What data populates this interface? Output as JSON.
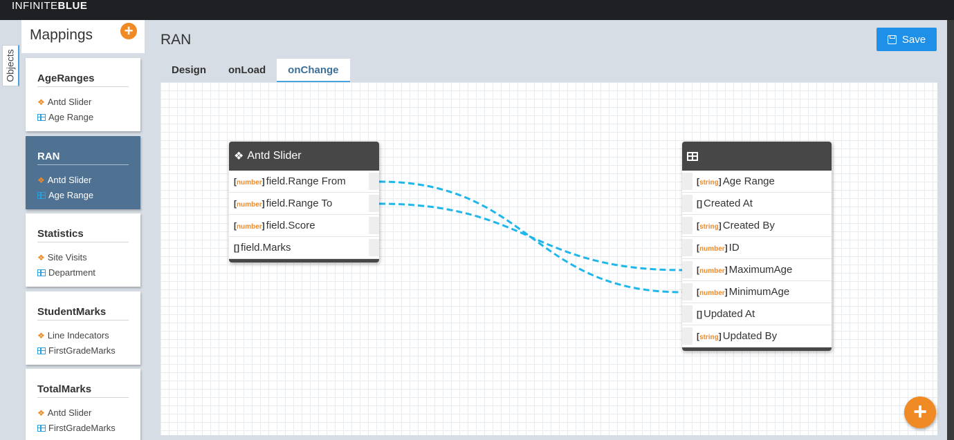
{
  "app": {
    "brand_thin": "INFINITE",
    "brand_bold": "BLUE"
  },
  "side_tab": {
    "label": "Objects"
  },
  "mappings": {
    "title": "Mappings",
    "add_label": "+",
    "items": [
      {
        "name": "AgeRanges",
        "component": "Antd Slider",
        "object": "Age Range"
      },
      {
        "name": "RAN",
        "component": "Antd Slider",
        "object": "Age Range"
      },
      {
        "name": "Statistics",
        "component": "Site Visits",
        "object": "Department"
      },
      {
        "name": "StudentMarks",
        "component": "Line Indecators",
        "object": "FirstGradeMarks"
      },
      {
        "name": "TotalMarks",
        "component": "Antd Slider",
        "object": "FirstGradeMarks"
      }
    ],
    "active_index": 1
  },
  "main": {
    "title": "RAN",
    "save_label": "Save",
    "tabs": [
      {
        "label": "Design"
      },
      {
        "label": "onLoad"
      },
      {
        "label": "onChange"
      }
    ],
    "active_tab": 2,
    "fab_label": "+"
  },
  "left_node": {
    "title": "Antd Slider",
    "fields": [
      {
        "type": "number",
        "name": "field.Range From"
      },
      {
        "type": "number",
        "name": "field.Range To"
      },
      {
        "type": "number",
        "name": "field.Score"
      },
      {
        "type": "",
        "name": "field.Marks"
      }
    ]
  },
  "right_node": {
    "title": "",
    "fields": [
      {
        "type": "string",
        "name": "Age Range"
      },
      {
        "type": "",
        "name": "Created At"
      },
      {
        "type": "string",
        "name": "Created By"
      },
      {
        "type": "number",
        "name": "ID"
      },
      {
        "type": "number",
        "name": "MaximumAge"
      },
      {
        "type": "number",
        "name": "MinimumAge"
      },
      {
        "type": "",
        "name": "Updated At"
      },
      {
        "type": "string",
        "name": "Updated By"
      }
    ]
  },
  "connections": [
    {
      "from": "field.Range From",
      "to": "MinimumAge"
    },
    {
      "from": "field.Range To",
      "to": "MaximumAge"
    }
  ],
  "colors": {
    "accent": "#1e90e8",
    "orange": "#f08a24",
    "wire": "#1fb6ea",
    "active_card": "#4f7292"
  },
  "icons": {
    "component": "cubes-icon",
    "object": "table-icon",
    "save": "floppy-icon"
  }
}
